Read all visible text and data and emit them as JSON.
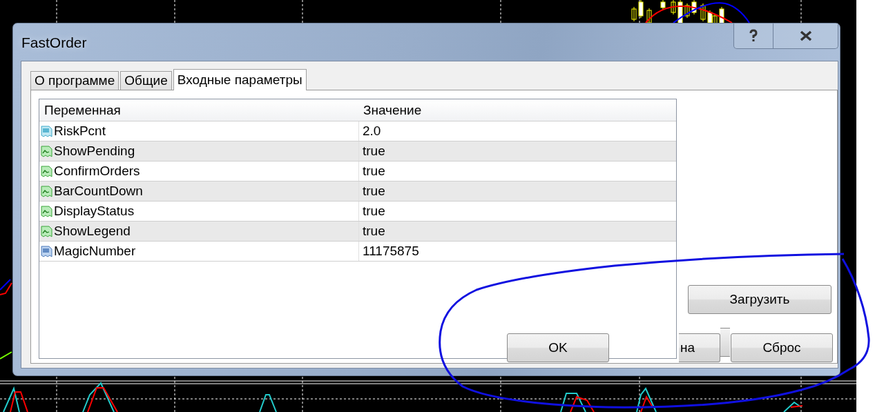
{
  "window": {
    "title": "FastOrder"
  },
  "tabs": [
    {
      "label": "О программе",
      "selected": false
    },
    {
      "label": "Общие",
      "selected": false
    },
    {
      "label": "Входные параметры",
      "selected": true
    }
  ],
  "table": {
    "columns": [
      "Переменная",
      "Значение"
    ],
    "rows": [
      {
        "name": "RiskPcnt",
        "value": "2.0",
        "kind": "double"
      },
      {
        "name": "ShowPending",
        "value": "true",
        "kind": "bool"
      },
      {
        "name": "ConfirmOrders",
        "value": "true",
        "kind": "bool"
      },
      {
        "name": "BarCountDown",
        "value": "true",
        "kind": "bool"
      },
      {
        "name": "DisplayStatus",
        "value": "true",
        "kind": "bool"
      },
      {
        "name": "ShowLegend",
        "value": "true",
        "kind": "bool"
      },
      {
        "name": "MagicNumber",
        "value": "11175875",
        "kind": "int"
      }
    ]
  },
  "side_buttons": [
    "Загрузить"
  ],
  "bottom_buttons": [
    {
      "label": "OK",
      "kind": "full"
    },
    {
      "label": "на",
      "kind": "covered"
    },
    {
      "label": "Сброс",
      "kind": "full"
    }
  ]
}
